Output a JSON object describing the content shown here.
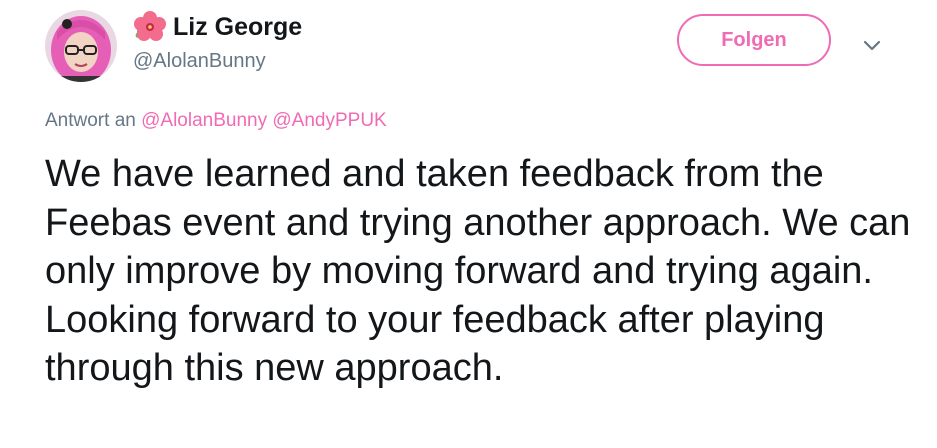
{
  "author": {
    "display_name": "Liz George",
    "handle": "@AlolanBunny",
    "avatar_icon": "avatar-photo",
    "name_emoji_icon": "hibiscus-icon"
  },
  "actions": {
    "follow_label": "Folgen",
    "more_icon": "chevron-down-icon"
  },
  "reply": {
    "prefix": "Antwort an",
    "mentions": [
      "@AlolanBunny",
      "@AndyPPUK"
    ]
  },
  "tweet": {
    "text": "We have learned and taken feedback from the Feebas event and trying another approach. We can only improve by moving forward and trying again. Looking forward to your feedback after playing through this new approach."
  },
  "colors": {
    "accent": "#f06ab4",
    "text": "#14171a",
    "secondary": "#657786"
  }
}
